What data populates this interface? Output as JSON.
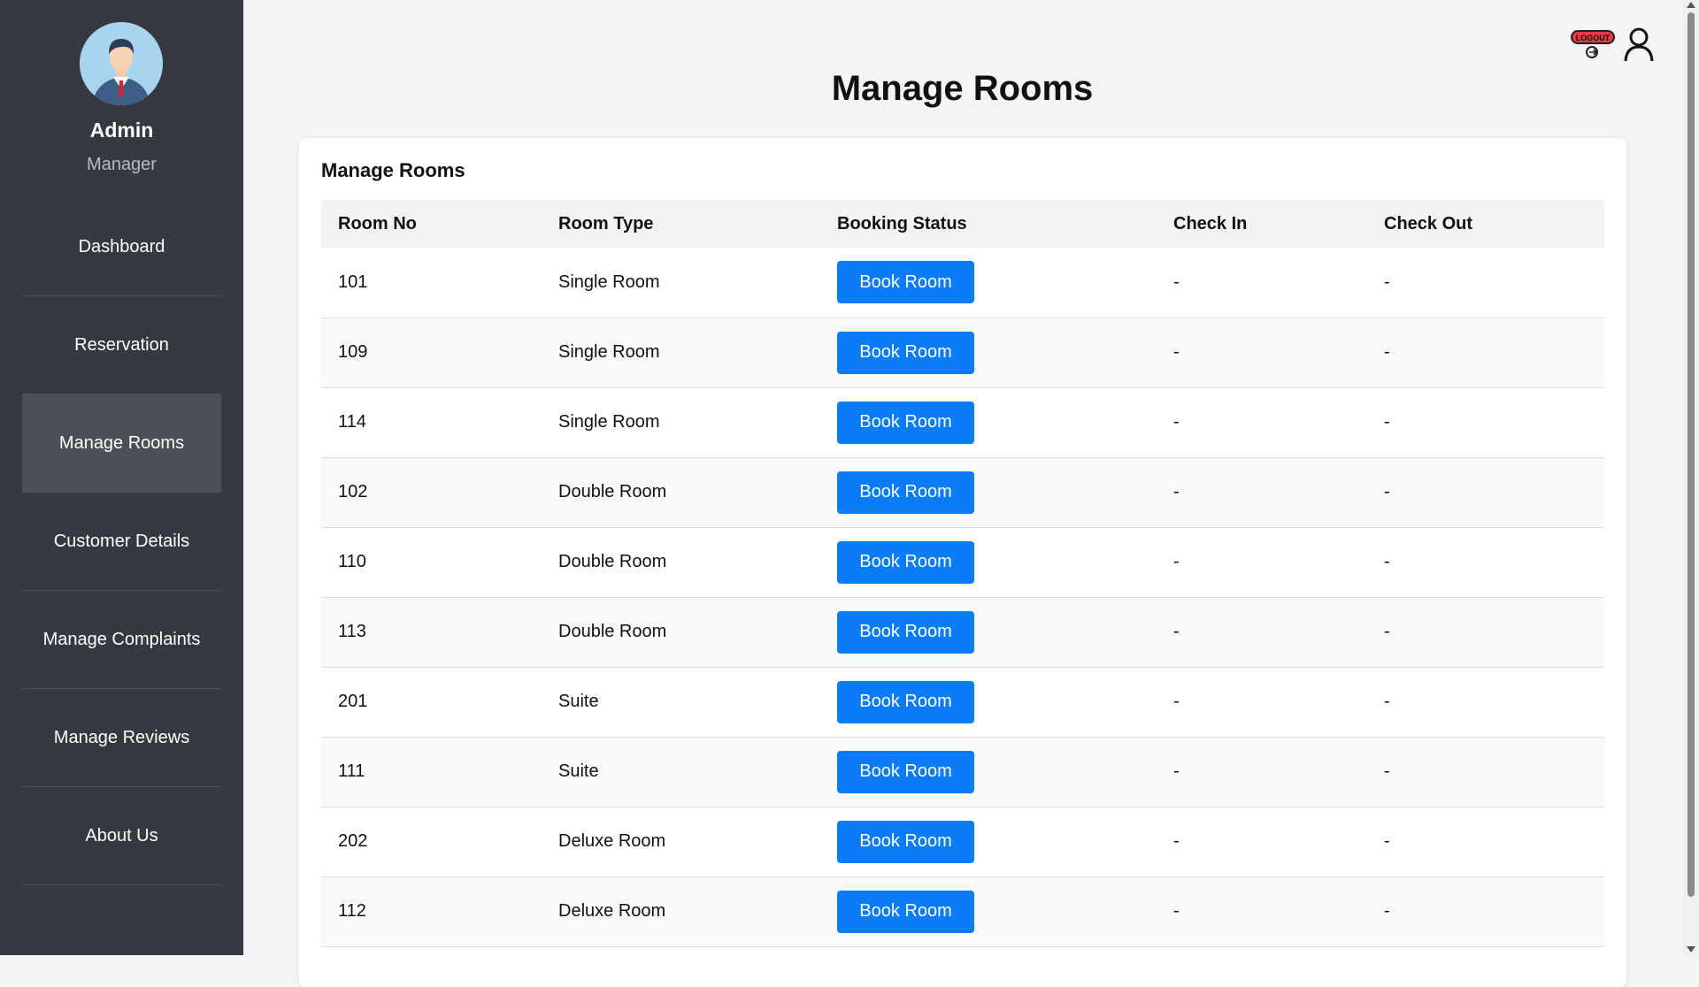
{
  "sidebar": {
    "name": "Admin",
    "role": "Manager",
    "items": [
      {
        "label": "Dashboard",
        "active": false
      },
      {
        "label": "Reservation",
        "active": false
      },
      {
        "label": "Manage Rooms",
        "active": true
      },
      {
        "label": "Customer Details",
        "active": false
      },
      {
        "label": "Manage Complaints",
        "active": false
      },
      {
        "label": "Manage Reviews",
        "active": false
      },
      {
        "label": "About Us",
        "active": false
      }
    ]
  },
  "header": {
    "title": "Manage Rooms",
    "logout_label": "LOGOUT",
    "icons": [
      "logout-icon",
      "user-icon"
    ]
  },
  "card": {
    "title": "Manage Rooms",
    "columns": [
      "Room No",
      "Room Type",
      "Booking Status",
      "Check In",
      "Check Out"
    ],
    "rows": [
      {
        "room_no": "101",
        "room_type": "Single Room",
        "action": "Book Room",
        "check_in": "-",
        "check_out": "-"
      },
      {
        "room_no": "109",
        "room_type": "Single Room",
        "action": "Book Room",
        "check_in": "-",
        "check_out": "-"
      },
      {
        "room_no": "114",
        "room_type": "Single Room",
        "action": "Book Room",
        "check_in": "-",
        "check_out": "-"
      },
      {
        "room_no": "102",
        "room_type": "Double Room",
        "action": "Book Room",
        "check_in": "-",
        "check_out": "-"
      },
      {
        "room_no": "110",
        "room_type": "Double Room",
        "action": "Book Room",
        "check_in": "-",
        "check_out": "-"
      },
      {
        "room_no": "113",
        "room_type": "Double Room",
        "action": "Book Room",
        "check_in": "-",
        "check_out": "-"
      },
      {
        "room_no": "201",
        "room_type": "Suite",
        "action": "Book Room",
        "check_in": "-",
        "check_out": "-"
      },
      {
        "room_no": "111",
        "room_type": "Suite",
        "action": "Book Room",
        "check_in": "-",
        "check_out": "-"
      },
      {
        "room_no": "202",
        "room_type": "Deluxe Room",
        "action": "Book Room",
        "check_in": "-",
        "check_out": "-"
      },
      {
        "room_no": "112",
        "room_type": "Deluxe Room",
        "action": "Book Room",
        "check_in": "-",
        "check_out": "-"
      }
    ]
  },
  "colors": {
    "sidebar_bg": "#343a40",
    "sidebar_active": "#4a5056",
    "button_primary": "#0a7cf5",
    "logout_badge": "#e23b45"
  }
}
